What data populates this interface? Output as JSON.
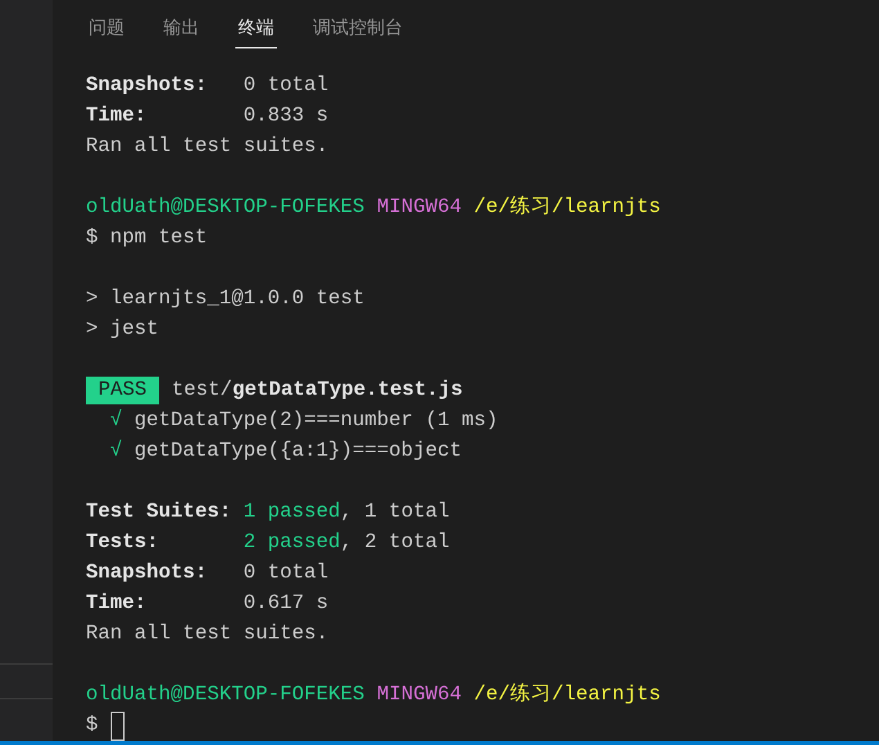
{
  "panel_tabs": [
    {
      "label": "问题",
      "selected": false
    },
    {
      "label": "输出",
      "selected": false
    },
    {
      "label": "终端",
      "selected": true
    },
    {
      "label": "调试控制台",
      "selected": false
    }
  ],
  "terminal": {
    "lines": [
      {
        "kind": "stat",
        "label": "Snapshots:",
        "value": [
          {
            "text": "0 total",
            "kind": "plain"
          }
        ]
      },
      {
        "kind": "stat",
        "label": "Time:",
        "value": [
          {
            "text": "0.833 s",
            "kind": "plain"
          }
        ]
      },
      {
        "kind": "output",
        "text": "Ran all test suites."
      },
      {
        "kind": "blank"
      },
      {
        "kind": "prompt",
        "user": "oldUath@DESKTOP-FOFEKES",
        "shell": "MINGW64",
        "path": "/e/练习/learnjts"
      },
      {
        "kind": "command",
        "symbol": "$",
        "text": "npm test"
      },
      {
        "kind": "blank"
      },
      {
        "kind": "output",
        "text": "> learnjts_1@1.0.0 test"
      },
      {
        "kind": "output",
        "text": "> jest"
      },
      {
        "kind": "blank"
      },
      {
        "kind": "pass",
        "badge": "PASS",
        "dir": "test/",
        "file": "getDataType.test.js"
      },
      {
        "kind": "check",
        "mark": "√",
        "text": "getDataType(2)===number (1 ms)"
      },
      {
        "kind": "check",
        "mark": "√",
        "text": "getDataType({a:1})===object"
      },
      {
        "kind": "blank"
      },
      {
        "kind": "stat",
        "label": "Test Suites:",
        "value": [
          {
            "text": "1 passed",
            "kind": "passed"
          },
          {
            "text": ", 1 total",
            "kind": "plain"
          }
        ]
      },
      {
        "kind": "stat",
        "label": "Tests:",
        "value": [
          {
            "text": "2 passed",
            "kind": "passed"
          },
          {
            "text": ", 2 total",
            "kind": "plain"
          }
        ]
      },
      {
        "kind": "stat",
        "label": "Snapshots:",
        "value": [
          {
            "text": "0 total",
            "kind": "plain"
          }
        ]
      },
      {
        "kind": "stat",
        "label": "Time:",
        "value": [
          {
            "text": "0.617 s",
            "kind": "plain"
          }
        ]
      },
      {
        "kind": "output",
        "text": "Ran all test suites."
      },
      {
        "kind": "blank"
      },
      {
        "kind": "prompt",
        "user": "oldUath@DESKTOP-FOFEKES",
        "shell": "MINGW64",
        "path": "/e/练习/learnjts"
      },
      {
        "kind": "cursor",
        "symbol": "$"
      }
    ]
  }
}
